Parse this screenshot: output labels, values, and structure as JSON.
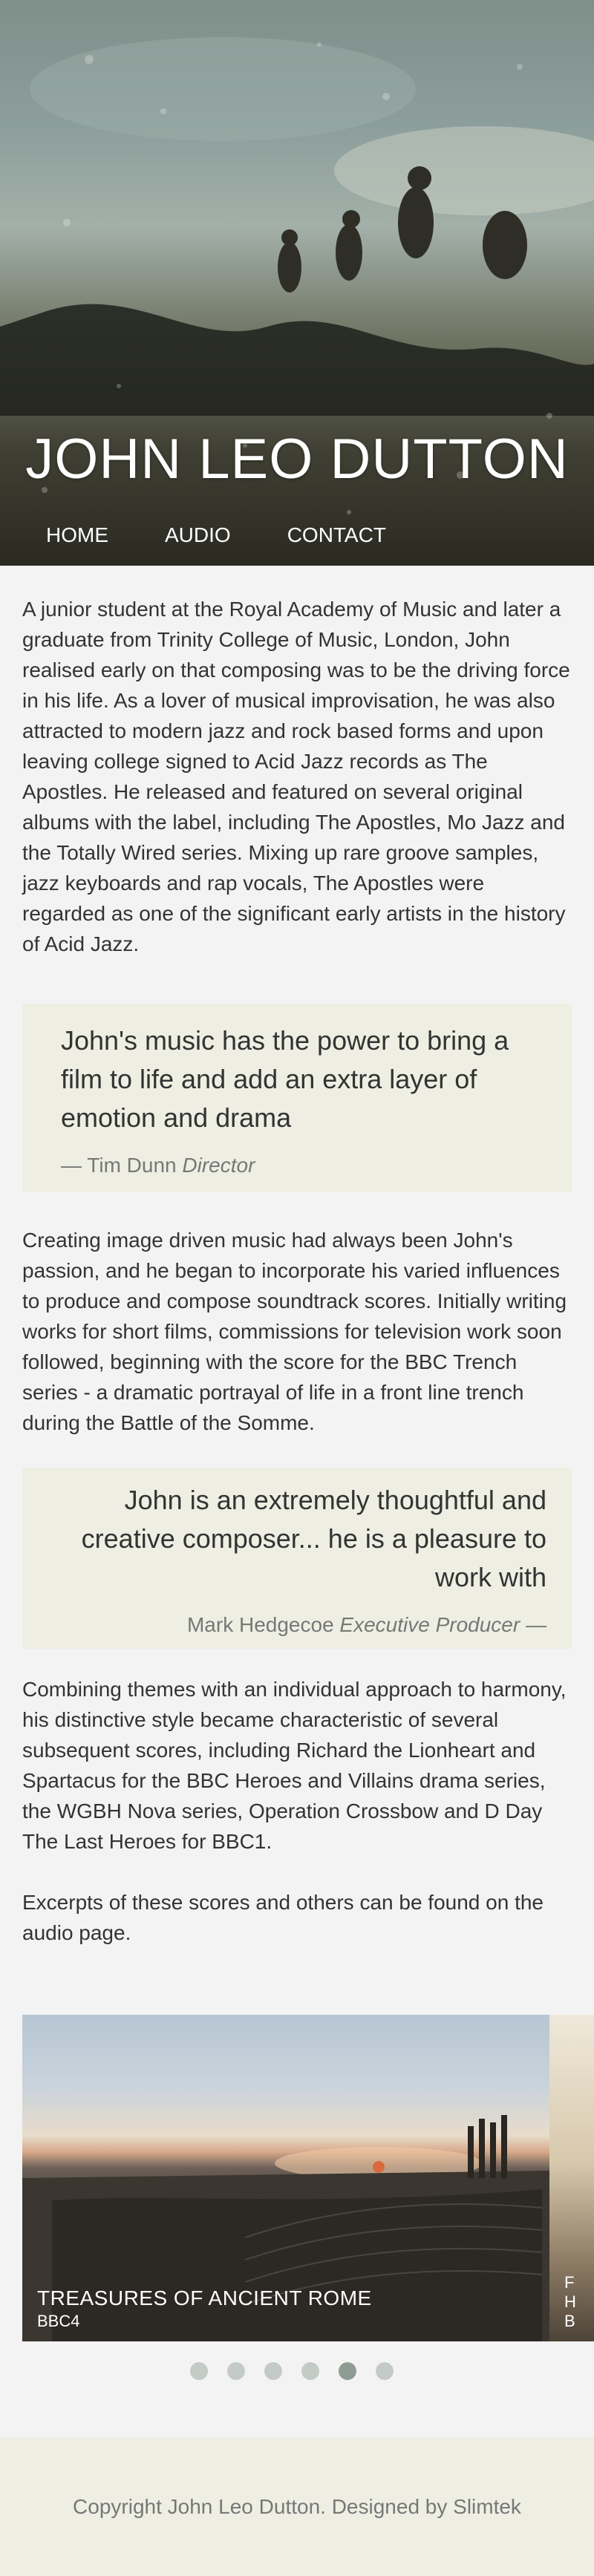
{
  "site": {
    "title": "JOHN LEO DUTTON"
  },
  "nav": {
    "items": [
      {
        "label": "HOME"
      },
      {
        "label": "AUDIO"
      },
      {
        "label": "CONTACT"
      }
    ]
  },
  "intro": "A junior student at the Royal Academy of Music and later a graduate from Trinity College of Music, London, John realised early on that composing was to be the driving force in his life. As a lover of musical improvisation, he was also attracted to modern jazz and rock based forms and upon leaving college signed to Acid Jazz records as The Apostles. He released and featured on several original albums with the label, including The Apostles, Mo Jazz and the Totally Wired series. Mixing up rare groove samples, jazz keyboards and rap vocals, The Apostles were regarded as one of the significant early artists in the history of Acid Jazz.",
  "quote1": {
    "text": "John's music has the power to bring a film to life and add an extra layer of emotion and drama",
    "dash": "— ",
    "name": "Tim Dunn",
    "role": "Director"
  },
  "para2": "Creating image driven music had always been John's passion, and he began to incorporate his varied influences to produce and compose soundtrack scores. Initially writing works for short films, commissions for television work soon followed, beginning with the score for the BBC Trench series - a dramatic portrayal of life in a front line trench during the Battle of the Somme.",
  "quote2": {
    "text": "John is an extremely thoughtful and creative composer... he is a pleasure to work with",
    "name": "Mark Hedgecoe",
    "role": "Executive Producer",
    "dash": " —"
  },
  "para3": "Combining themes with an individual approach to harmony, his distinctive style became characteristic of several subsequent scores, including Richard the Lionheart and Spartacus for the BBC Heroes and Villains drama series, the WGBH Nova series, Operation Crossbow and D Day The Last Heroes for BBC1.",
  "para4": "Excerpts of these scores and others can be found on the audio page.",
  "carousel": {
    "slides": [
      {
        "title": "TREASURES OF ANCIENT ROME",
        "subtitle": "BBC4"
      }
    ],
    "next_fragment": "F\nH\nB",
    "dot_count": 6,
    "active_dot": 5
  },
  "footer": {
    "text": "Copyright John Leo Dutton. Designed by Slimtek"
  }
}
